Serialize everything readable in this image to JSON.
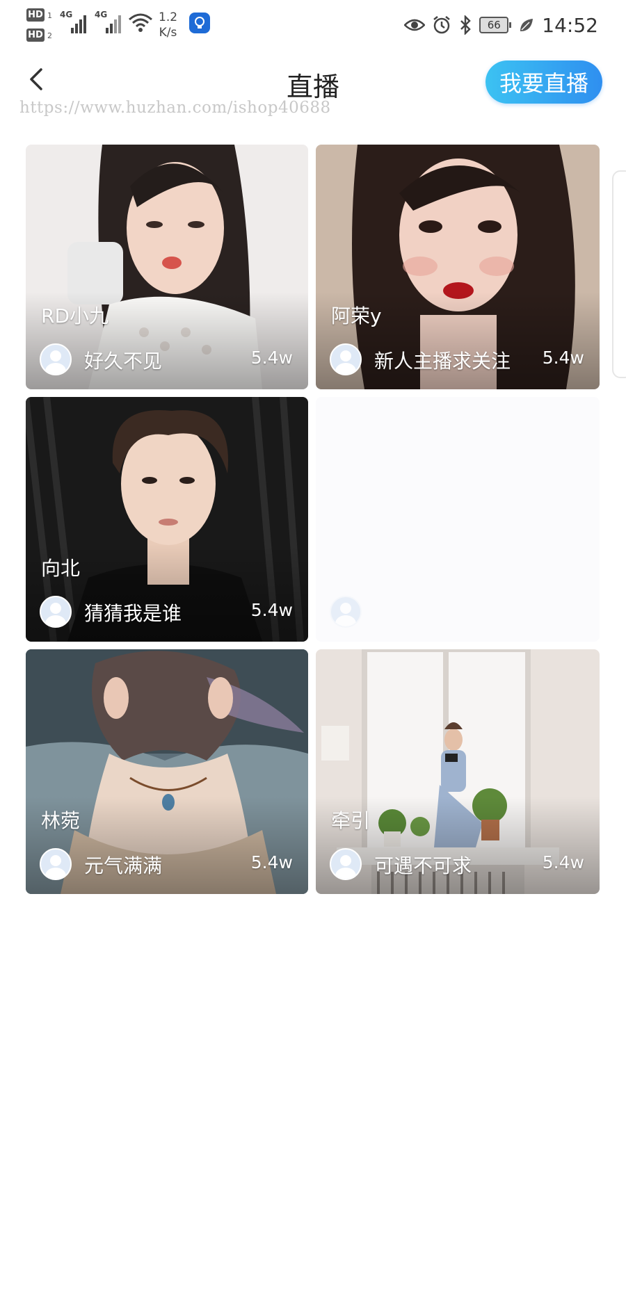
{
  "status_bar": {
    "hd1": "HD",
    "hd1_num": "1",
    "hd2": "HD",
    "hd2_num": "2",
    "net1": "4G",
    "net2": "4G",
    "speed_value": "1.2",
    "speed_unit": "K/s",
    "battery": "66",
    "time": "14:52",
    "icons": [
      "eye-icon",
      "alarm-icon",
      "bluetooth-icon",
      "battery-icon",
      "leaf-icon",
      "wifi-icon",
      "signal-icon"
    ]
  },
  "header": {
    "back_icon": "chevron-left-icon",
    "title": "直播",
    "watermark": "https://www.huzhan.com/ishop40688",
    "action_label": "我要直播",
    "accent_color": "#2f8ff0"
  },
  "rooms": [
    {
      "name": "RD小九",
      "desc": "好久不见",
      "views": "5.4w"
    },
    {
      "name": "阿荣y",
      "desc": "新人主播求关注",
      "views": "5.4w"
    },
    {
      "name": "向北",
      "desc": "猜猜我是谁",
      "views": "5.4w"
    },
    {
      "name": "",
      "desc": "",
      "views": ""
    },
    {
      "name": "林菀",
      "desc": "元气满满",
      "views": "5.4w"
    },
    {
      "name": "牵引",
      "desc": "可遇不可求",
      "views": "5.4w"
    }
  ]
}
